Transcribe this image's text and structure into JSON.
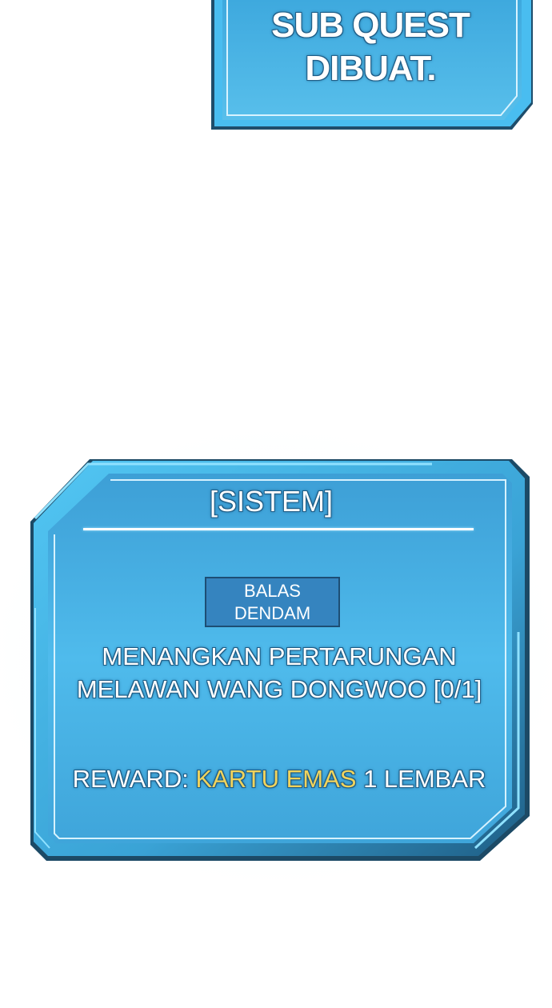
{
  "top_panel": {
    "line1": "SUB QUEST",
    "line2": "DIBUAT."
  },
  "system_panel": {
    "title": "[SISTEM]",
    "badge": {
      "line1": "BALAS",
      "line2": "DENDAM"
    },
    "quest_line1": "MENANGKAN PERTARUNGAN",
    "quest_line2": "MELAWAN WANG DONGWOO  [0/1]",
    "reward_label": "REWARD:",
    "reward_item": "KARTU EMAS",
    "reward_amount": "1 LEMBAR"
  },
  "colors": {
    "panel_fill": "#45b4ea",
    "panel_frame": "#3aa6d8",
    "panel_frame_dark": "#1c4a66",
    "reward_item": "#f0d35c"
  }
}
